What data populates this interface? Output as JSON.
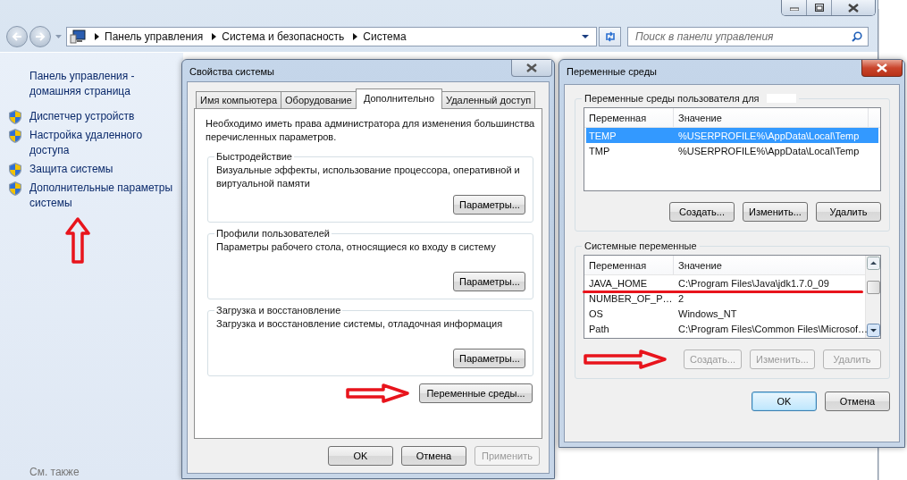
{
  "explorer": {
    "breadcrumb": [
      "Панель управления",
      "Система и безопасность",
      "Система"
    ],
    "search": {
      "placeholder": "Поиск в панели управления"
    }
  },
  "sidebar": {
    "home_link": "Панель управления - домашняя страница",
    "items": [
      {
        "label": "Диспетчер устройств",
        "marked": false
      },
      {
        "label": "Настройка удаленного доступа",
        "marked": false
      },
      {
        "label": "Защита системы",
        "marked": false
      },
      {
        "label": "Дополнительные параметры системы",
        "marked": true
      }
    ],
    "see_also": "См. также"
  },
  "system_properties": {
    "title": "Свойства системы",
    "tabs": [
      {
        "label": "Имя компьютера",
        "selected": false
      },
      {
        "label": "Оборудование",
        "selected": false
      },
      {
        "label": "Дополнительно",
        "selected": true
      },
      {
        "label": "Удаленный доступ",
        "selected": false
      }
    ],
    "notice": "Необходимо иметь права администратора для изменения большинства перечисленных параметров.",
    "groups": [
      {
        "title": "Быстродействие",
        "text": "Визуальные эффекты, использование процессора, оперативной и виртуальной памяти",
        "button": "Параметры..."
      },
      {
        "title": "Профили пользователей",
        "text": "Параметры рабочего стола, относящиеся ко входу в систему",
        "button": "Параметры..."
      },
      {
        "title": "Загрузка и восстановление",
        "text": "Загрузка и восстановление системы, отладочная информация",
        "button": "Параметры..."
      }
    ],
    "env_button": {
      "label": "Переменные среды...",
      "marked": true
    },
    "buttons": [
      {
        "label": "OK",
        "disabled": false
      },
      {
        "label": "Отмена",
        "disabled": false
      },
      {
        "label": "Применить",
        "disabled": true
      }
    ]
  },
  "environment": {
    "title": "Переменные среды",
    "groups": [
      {
        "title": "Переменные среды пользователя для",
        "redacted": true,
        "columns": [
          "Переменная",
          "Значение"
        ],
        "scrollbar": false,
        "marked": false,
        "rows": [
          {
            "name": "TEMP",
            "value": "%USERPROFILE%\\AppData\\Local\\Temp",
            "selected": true,
            "marked": false
          },
          {
            "name": "TMP",
            "value": "%USERPROFILE%\\AppData\\Local\\Temp",
            "selected": false,
            "marked": false
          }
        ],
        "buttons": [
          {
            "label": "Создать...",
            "disabled": false
          },
          {
            "label": "Изменить...",
            "disabled": false
          },
          {
            "label": "Удалить",
            "disabled": false
          }
        ]
      },
      {
        "title": "Системные переменные",
        "redacted": false,
        "columns": [
          "Переменная",
          "Значение"
        ],
        "scrollbar": true,
        "marked": true,
        "rows": [
          {
            "name": "JAVA_HOME",
            "value": "C:\\Program Files\\Java\\jdk1.7.0_09",
            "selected": false,
            "marked": true
          },
          {
            "name": "NUMBER_OF_P…",
            "value": "2",
            "selected": false,
            "marked": false
          },
          {
            "name": "OS",
            "value": "Windows_NT",
            "selected": false,
            "marked": false
          },
          {
            "name": "Path",
            "value": "C:\\Program Files\\Common Files\\Microsof…",
            "selected": false,
            "marked": false
          }
        ],
        "buttons": [
          {
            "label": "Создать...",
            "disabled": true
          },
          {
            "label": "Изменить...",
            "disabled": true
          },
          {
            "label": "Удалить",
            "disabled": true
          }
        ]
      }
    ],
    "buttons": [
      {
        "label": "OK",
        "default": true
      },
      {
        "label": "Отмена",
        "default": false
      }
    ]
  }
}
